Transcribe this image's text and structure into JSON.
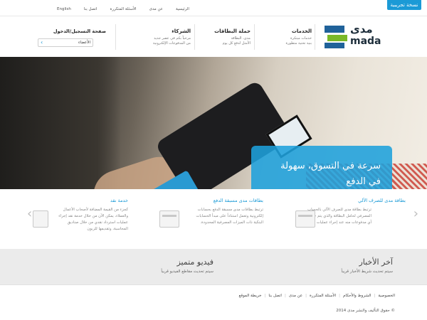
{
  "beta_label": "نسخة تجريبية",
  "top_nav": [
    "English",
    "اتصل بنا",
    "الأسئلة المتكررة",
    "عن مدى",
    "الرئيسية"
  ],
  "logo": {
    "arabic": "مدى",
    "english": "mada"
  },
  "nav": {
    "services": {
      "title": "الخدمات",
      "desc1": "خدمات مبتكرة",
      "desc2": "بنية تحتية متطورة"
    },
    "campaign": {
      "title": "حملة البطاقات",
      "desc1": "مدى، البطاقة",
      "desc2": "الأمثل لدفع كل يوم"
    },
    "partners": {
      "title": "الشركاء",
      "desc1": "مرحباً بكم في عصر جديد",
      "desc2": "من المدفوعات الإلكترونية"
    },
    "login": {
      "title": "صفحة التسجيل/الدخول",
      "member_label": "الأعضاء"
    }
  },
  "hero": {
    "line1": "سرعة في التسوق، سهولة",
    "line2": "في الدفع"
  },
  "features": [
    {
      "title": "بطاقة مدى للصرف الآلي",
      "desc": "ترتبط بطاقة مدى للصرف الآلي بالحساب المصرفي لحامل البطاقة والذي يتم خصم قيمة أي مدفوعات منه عند إجراء عمليات شراء..."
    },
    {
      "title": "بطاقات مدى مسبقة الدفع",
      "desc": "ترتبط بطاقات مدى مسبقة الدفع بحسابات إلكترونية وتعمل استناداً على مبدأ الحسابات البنكية ذات الميزات المصرفية المحدودة."
    },
    {
      "title": "خدمة نقد",
      "desc": "كجزء من القيمة المضافة لأصحاب الأعمال والعملاء، يمكن الآن من خلال خدمة نقد إجراء عمليات استرداد نقدي من خلال صناديق المحاسبة، وتقديمها للزبون"
    }
  ],
  "news": {
    "title": "آخر الأخبار",
    "subtitle": "سيتم تحديث شريط الأخبار قريباً"
  },
  "video": {
    "title": "فيديو متميز",
    "subtitle": "سيتم تحديث مقاطع الفيديو قريباً"
  },
  "footer_links": [
    "الخصوصية",
    "الشروط والأحكام",
    "الأسئلة المتكررة",
    "عن مدى",
    "اتصل بنا",
    "خريطة الموقع"
  ],
  "copyright": "© حقوق التأليف والنشر مدى 2014",
  "colors": {
    "accent": "#1b9ad6",
    "brand_blue": "#20629a",
    "brand_green": "#7ab828"
  }
}
